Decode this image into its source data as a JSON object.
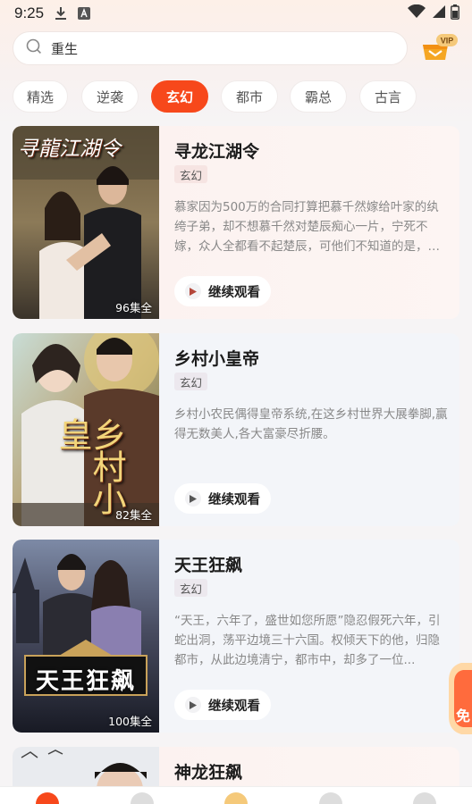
{
  "status_bar": {
    "time": "9:25",
    "icons": [
      "download-icon",
      "notification-a-icon",
      "wifi-icon",
      "signal-icon",
      "battery-icon"
    ]
  },
  "search": {
    "value": "重生",
    "icon": "search-icon"
  },
  "vip_badge": "VIP",
  "tabs": [
    {
      "label": "精选",
      "active": false
    },
    {
      "label": "逆袭",
      "active": false
    },
    {
      "label": "玄幻",
      "active": true
    },
    {
      "label": "都市",
      "active": false
    },
    {
      "label": "霸总",
      "active": false
    },
    {
      "label": "古言",
      "active": false
    }
  ],
  "cards": [
    {
      "title": "寻龙江湖令",
      "tag": "玄幻",
      "description": "慕家因为500万的合同打算把慕千然嫁给叶家的纨绔子弟，却不想慕千然对楚辰痴心一片，宁死不嫁，众人全都看不起楚辰，可他们不知道的是，楚辰的真实身份...",
      "episodes": "96集全",
      "cover_text": "寻龍江湖令",
      "button": "继续观看"
    },
    {
      "title": "乡村小皇帝",
      "tag": "玄幻",
      "description": "乡村小农民偶得皇帝系统,在这乡村世界大展拳脚,赢得无数美人,各大富豪尽折腰。",
      "episodes": "82集全",
      "cover_text": "乡村小皇",
      "button": "继续观看"
    },
    {
      "title": "天王狂飙",
      "tag": "玄幻",
      "description": "“天王，六年了，盛世如您所愿”隐忍假死六年，引蛇出洞，荡平边境三十六国。权倾天下的他，归隐都市，从此边境清宁，都市中，却多了一位...",
      "episodes": "100集全",
      "cover_text": "天王狂飙",
      "button": "继续观看"
    },
    {
      "title": "神龙狂飙"
    }
  ],
  "promo_text": "免",
  "colors": {
    "accent": "#f7481b",
    "card_warm": "#fbf1ef",
    "card_cool": "#f3f5f9"
  }
}
